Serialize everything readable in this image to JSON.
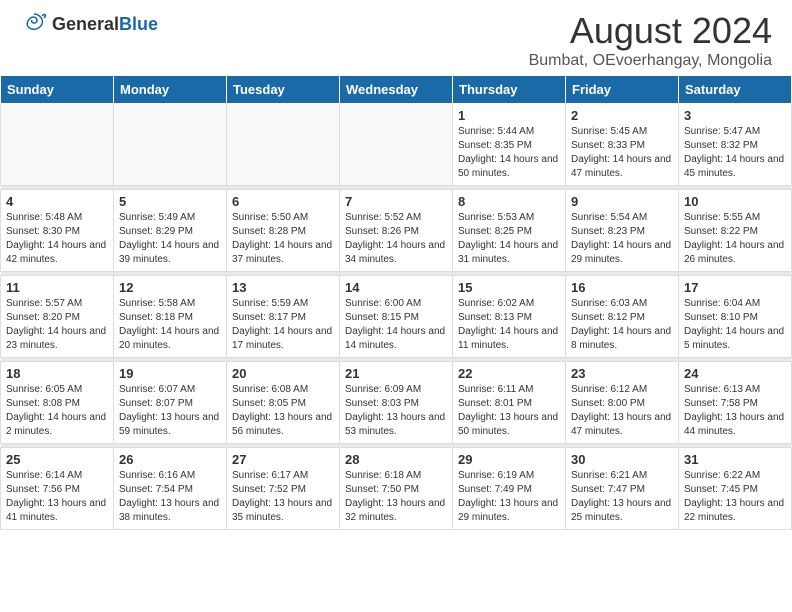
{
  "header": {
    "logo_general": "General",
    "logo_blue": "Blue",
    "month_year": "August 2024",
    "location": "Bumbat, OEvoerhangay, Mongolia"
  },
  "weekdays": [
    "Sunday",
    "Monday",
    "Tuesday",
    "Wednesday",
    "Thursday",
    "Friday",
    "Saturday"
  ],
  "weeks": [
    [
      {
        "day": "",
        "info": "",
        "empty": true
      },
      {
        "day": "",
        "info": "",
        "empty": true
      },
      {
        "day": "",
        "info": "",
        "empty": true
      },
      {
        "day": "",
        "info": "",
        "empty": true
      },
      {
        "day": "1",
        "info": "Sunrise: 5:44 AM\nSunset: 8:35 PM\nDaylight: 14 hours\nand 50 minutes."
      },
      {
        "day": "2",
        "info": "Sunrise: 5:45 AM\nSunset: 8:33 PM\nDaylight: 14 hours\nand 47 minutes."
      },
      {
        "day": "3",
        "info": "Sunrise: 5:47 AM\nSunset: 8:32 PM\nDaylight: 14 hours\nand 45 minutes."
      }
    ],
    [
      {
        "day": "4",
        "info": "Sunrise: 5:48 AM\nSunset: 8:30 PM\nDaylight: 14 hours\nand 42 minutes."
      },
      {
        "day": "5",
        "info": "Sunrise: 5:49 AM\nSunset: 8:29 PM\nDaylight: 14 hours\nand 39 minutes."
      },
      {
        "day": "6",
        "info": "Sunrise: 5:50 AM\nSunset: 8:28 PM\nDaylight: 14 hours\nand 37 minutes."
      },
      {
        "day": "7",
        "info": "Sunrise: 5:52 AM\nSunset: 8:26 PM\nDaylight: 14 hours\nand 34 minutes."
      },
      {
        "day": "8",
        "info": "Sunrise: 5:53 AM\nSunset: 8:25 PM\nDaylight: 14 hours\nand 31 minutes."
      },
      {
        "day": "9",
        "info": "Sunrise: 5:54 AM\nSunset: 8:23 PM\nDaylight: 14 hours\nand 29 minutes."
      },
      {
        "day": "10",
        "info": "Sunrise: 5:55 AM\nSunset: 8:22 PM\nDaylight: 14 hours\nand 26 minutes."
      }
    ],
    [
      {
        "day": "11",
        "info": "Sunrise: 5:57 AM\nSunset: 8:20 PM\nDaylight: 14 hours\nand 23 minutes."
      },
      {
        "day": "12",
        "info": "Sunrise: 5:58 AM\nSunset: 8:18 PM\nDaylight: 14 hours\nand 20 minutes."
      },
      {
        "day": "13",
        "info": "Sunrise: 5:59 AM\nSunset: 8:17 PM\nDaylight: 14 hours\nand 17 minutes."
      },
      {
        "day": "14",
        "info": "Sunrise: 6:00 AM\nSunset: 8:15 PM\nDaylight: 14 hours\nand 14 minutes."
      },
      {
        "day": "15",
        "info": "Sunrise: 6:02 AM\nSunset: 8:13 PM\nDaylight: 14 hours\nand 11 minutes."
      },
      {
        "day": "16",
        "info": "Sunrise: 6:03 AM\nSunset: 8:12 PM\nDaylight: 14 hours\nand 8 minutes."
      },
      {
        "day": "17",
        "info": "Sunrise: 6:04 AM\nSunset: 8:10 PM\nDaylight: 14 hours\nand 5 minutes."
      }
    ],
    [
      {
        "day": "18",
        "info": "Sunrise: 6:05 AM\nSunset: 8:08 PM\nDaylight: 14 hours\nand 2 minutes."
      },
      {
        "day": "19",
        "info": "Sunrise: 6:07 AM\nSunset: 8:07 PM\nDaylight: 13 hours\nand 59 minutes."
      },
      {
        "day": "20",
        "info": "Sunrise: 6:08 AM\nSunset: 8:05 PM\nDaylight: 13 hours\nand 56 minutes."
      },
      {
        "day": "21",
        "info": "Sunrise: 6:09 AM\nSunset: 8:03 PM\nDaylight: 13 hours\nand 53 minutes."
      },
      {
        "day": "22",
        "info": "Sunrise: 6:11 AM\nSunset: 8:01 PM\nDaylight: 13 hours\nand 50 minutes."
      },
      {
        "day": "23",
        "info": "Sunrise: 6:12 AM\nSunset: 8:00 PM\nDaylight: 13 hours\nand 47 minutes."
      },
      {
        "day": "24",
        "info": "Sunrise: 6:13 AM\nSunset: 7:58 PM\nDaylight: 13 hours\nand 44 minutes."
      }
    ],
    [
      {
        "day": "25",
        "info": "Sunrise: 6:14 AM\nSunset: 7:56 PM\nDaylight: 13 hours\nand 41 minutes."
      },
      {
        "day": "26",
        "info": "Sunrise: 6:16 AM\nSunset: 7:54 PM\nDaylight: 13 hours\nand 38 minutes."
      },
      {
        "day": "27",
        "info": "Sunrise: 6:17 AM\nSunset: 7:52 PM\nDaylight: 13 hours\nand 35 minutes."
      },
      {
        "day": "28",
        "info": "Sunrise: 6:18 AM\nSunset: 7:50 PM\nDaylight: 13 hours\nand 32 minutes."
      },
      {
        "day": "29",
        "info": "Sunrise: 6:19 AM\nSunset: 7:49 PM\nDaylight: 13 hours\nand 29 minutes."
      },
      {
        "day": "30",
        "info": "Sunrise: 6:21 AM\nSunset: 7:47 PM\nDaylight: 13 hours\nand 25 minutes."
      },
      {
        "day": "31",
        "info": "Sunrise: 6:22 AM\nSunset: 7:45 PM\nDaylight: 13 hours\nand 22 minutes."
      }
    ]
  ]
}
